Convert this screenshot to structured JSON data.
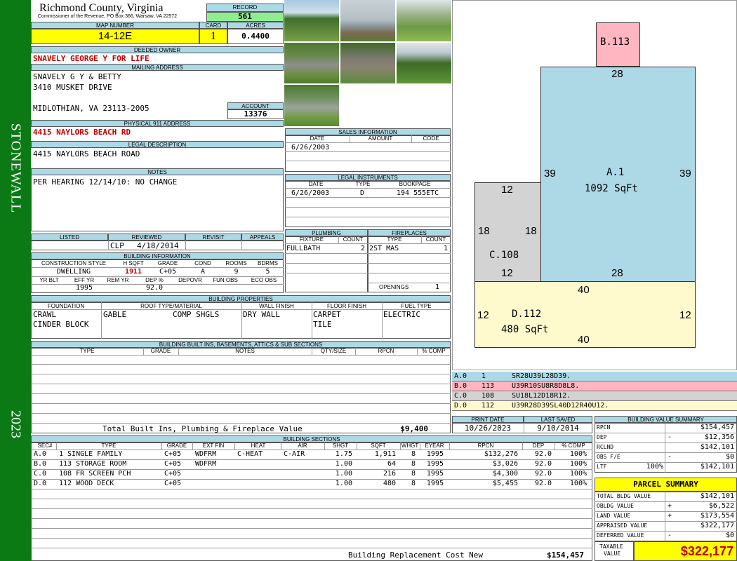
{
  "side": {
    "district": "STONEWALL",
    "year": "2023"
  },
  "county": {
    "title": "Richmond County, Virginia",
    "subtitle": "Commissioner of the Revenue, PO Box 366, Warsaw, VA 22572"
  },
  "record": {
    "label": "RECORD",
    "value": "561"
  },
  "map": {
    "map_number_label": "MAP NUMBER",
    "map_number": "14-12E",
    "card_label": "CARD",
    "card": "1",
    "acres_label": "ACRES",
    "acres": "0.4400"
  },
  "owner": {
    "deeded_label": "DEEDED OWNER",
    "deeded": "SNAVELY GEORGE Y FOR LIFE",
    "mailing_label": "MAILING ADDRESS",
    "mail1": "SNAVELY G Y & BETTY",
    "mail2": "3410 MUSKET DRIVE",
    "mail3": "MIDLOTHIAN, VA 23113-2005",
    "account_label": "ACCOUNT",
    "account": "13376"
  },
  "physical": {
    "label": "PHYSICAL 911 ADDRESS",
    "value": "4415 NAYLORS BEACH RD"
  },
  "legal": {
    "label": "LEGAL DESCRIPTION",
    "value": "4415 NAYLORS BEACH ROAD"
  },
  "notes": {
    "label": "NOTES",
    "value": "PER HEARING 12/14/10: NO CHANGE"
  },
  "review": {
    "listed_label": "LISTED",
    "reviewed_label": "REVIEWED",
    "revisit_label": "REVISIT",
    "appeals_label": "APPEALS",
    "reviewed_by": "CLP",
    "reviewed_date": "4/18/2014"
  },
  "building_info": {
    "label": "BUILDING INFORMATION",
    "h": [
      "CONSTRUCTION STYLE",
      "H SQFT",
      "GRADE",
      "COND",
      "ROOMS",
      "BDRMS"
    ],
    "v": [
      "DWELLING",
      "1911",
      "C+05",
      "A",
      "9",
      "5"
    ],
    "h2": [
      "YR BLT",
      "EFF YR",
      "REM YR",
      "DEP %",
      "DEPOVR",
      "FUN OBS",
      "ECO OBS"
    ],
    "v2": [
      "",
      "1995",
      "",
      "92.0",
      "",
      "",
      ""
    ]
  },
  "sales": {
    "label": "SALES INFORMATION",
    "h": [
      "DATE",
      "AMOUNT",
      "CODE"
    ],
    "date": "6/26/2003"
  },
  "instruments": {
    "label": "LEGAL INSTRUMENTS",
    "h": [
      "DATE",
      "TYPE",
      "BOOKPAGE"
    ],
    "date": "6/26/2003",
    "type": "D",
    "bookpage": "194 555ETC"
  },
  "plumbing": {
    "label": "PLUMBING",
    "h": [
      "FIXTURE",
      "COUNT"
    ],
    "fixture": "FULLBATH",
    "count": "2"
  },
  "fireplaces": {
    "label": "FIREPLACES",
    "h": [
      "TYPE",
      "COUNT"
    ],
    "type": "2ST MAS",
    "count": "1",
    "openings_label": "OPENINGS",
    "openings": "1"
  },
  "properties": {
    "label": "BUILDING PROPERTIES",
    "h": [
      "FOUNDATION",
      "ROOF TYPE/MATERIAL",
      "WALL FINISH",
      "FLOOR FINISH",
      "FUEL TYPE"
    ],
    "foundation": [
      "CRAWL",
      "CINDER BLOCK"
    ],
    "roof_type": "GABLE",
    "roof_material": "COMP SHGLS",
    "wall": "DRY WALL",
    "floor": [
      "CARPET",
      "TILE"
    ],
    "fuel": "ELECTRIC"
  },
  "builtins": {
    "label": "BUILDING BUILT INS, BASEMENTS, ATTICS & SUB SECTIONS",
    "h": [
      "TYPE",
      "GRADE",
      "NOTES",
      "QTY/SIZE",
      "RPCN",
      "% COMP"
    ],
    "total_label": "Total Built Ins, Plumbing & Fireplace Value",
    "total": "$9,400"
  },
  "dates": {
    "print_label": "PRINT DATE",
    "print": "10/26/2023",
    "saved_label": "LAST SAVED",
    "saved": "9/10/2014"
  },
  "sections": {
    "label": "BUILDING SECTIONS",
    "h": [
      "SEC#",
      "TYPE",
      "GRADE",
      "EXT FIN",
      "HEAT",
      "AIR",
      "SHGT",
      "SQFT",
      "WHGT",
      "EYEAR",
      "RPCN",
      "DEP",
      "% COMP"
    ],
    "rows": [
      [
        "A.0",
        "1 SINGLE FAMILY",
        "C+05",
        "WDFRM",
        "C-HEAT",
        "C-AIR",
        "1.75",
        "1,911",
        "8",
        "1995",
        "$132,276",
        "92.0",
        "100%"
      ],
      [
        "B.0",
        "113 STORAGE ROOM",
        "C+05",
        "WDFRM",
        "",
        "",
        "1.00",
        "64",
        "8",
        "1995",
        "$3,026",
        "92.0",
        "100%"
      ],
      [
        "C.0",
        "108 FR SCREEN PCH",
        "C+05",
        "",
        "",
        "",
        "1.00",
        "216",
        "8",
        "1995",
        "$4,300",
        "92.0",
        "100%"
      ],
      [
        "D.0",
        "112 WOOD DECK",
        "C+05",
        "",
        "",
        "",
        "1.00",
        "480",
        "8",
        "1995",
        "$5,455",
        "92.0",
        "100%"
      ]
    ],
    "replacement_label": "Building Replacement Cost New",
    "replacement": "$154,457"
  },
  "sketch": {
    "b_label": "B.113",
    "b_top": "28",
    "a_label": "A.1",
    "a_sqft": "1092 SqFt",
    "a_left": "39",
    "a_right": "39",
    "a_bottom": "28",
    "c_label": "C.108",
    "c_top": "12",
    "c_left": "18",
    "c_right": "18",
    "c_bottom": "12",
    "d_label": "D.112",
    "d_sqft": "480 SqFt",
    "d_top": "40",
    "d_left": "12",
    "d_right": "12",
    "d_bottom": "40"
  },
  "vectors": [
    {
      "sec": "A.0",
      "num": "1",
      "code": "SR28U39L28D39.",
      "color": "#add8e6"
    },
    {
      "sec": "B.0",
      "num": "113",
      "code": "U39R10SU8R8D8L8.",
      "color": "#ffb6c1"
    },
    {
      "sec": "C.0",
      "num": "108",
      "code": "SU18L12D18R12.",
      "color": "#d3d3d3"
    },
    {
      "sec": "D.0",
      "num": "112",
      "code": "U39R28D39SL40D12R40U12.",
      "color": "#fffacd"
    }
  ],
  "value_summary": {
    "label": "BUILDING VALUE SUMMARY",
    "rpcn_label": "RPCN",
    "rpcn": "$154,457",
    "dep_label": "DEP",
    "dep_sign": "-",
    "dep": "$12,356",
    "rclnd_label": "RCLND",
    "rclnd": "$142,101",
    "obs_label": "OBS F/E",
    "obs_sign": "-",
    "obs": "$0",
    "ltf_label": "LTF",
    "ltf_pct": "100%",
    "ltf": "$142,101"
  },
  "parcel": {
    "label": "PARCEL SUMMARY",
    "total_bldg_label": "TOTAL BLDG VALUE",
    "total_bldg": "$142,101",
    "obldg_label": "OBLDG VALUE",
    "obldg_sign": "+",
    "obldg": "$6,522",
    "land_label": "LAND VALUE",
    "land_sign": "+",
    "land": "$173,554",
    "appraised_label": "APPRAISED VALUE",
    "appraised": "$322,177",
    "deferred_label": "DEFERRED VALUE",
    "deferred_sign": "-",
    "deferred": "$0",
    "taxable_label1": "TAXABLE",
    "taxable_label2": "VALUE",
    "taxable": "$322,177"
  },
  "colors": {
    "side": "#0b7a15",
    "header": "#add8e6",
    "yellow": "#ffff00",
    "record": "#90ee90",
    "red": "#c00000"
  }
}
